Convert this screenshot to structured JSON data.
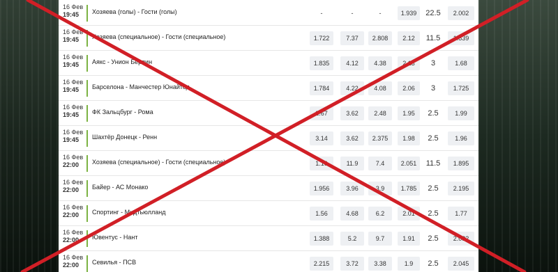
{
  "events": [
    {
      "date": "16 Фев",
      "time": "19:45",
      "teams": "Хозяева (голы) - Гости (голы)",
      "odds": [
        "-",
        "-",
        "-",
        "1.939"
      ],
      "total": "22.5",
      "last": "2.002"
    },
    {
      "date": "16 Фев",
      "time": "19:45",
      "teams": "Хозяева (специальное) - Гости (специальное)",
      "odds": [
        "1.722",
        "7.37",
        "2.808",
        "2.12"
      ],
      "total": "11.5",
      "last": "1.839"
    },
    {
      "date": "16 Фев",
      "time": "19:45",
      "teams": "Аякс - Унион Берлин",
      "odds": [
        "1.835",
        "4.12",
        "4.38",
        "2.13"
      ],
      "total": "3",
      "last": "1.68"
    },
    {
      "date": "16 Фев",
      "time": "19:45",
      "teams": "Барселона - Манчестер Юнайтед",
      "odds": [
        "1.784",
        "4.22",
        "4.08",
        "2.06"
      ],
      "total": "3",
      "last": "1.725"
    },
    {
      "date": "16 Фев",
      "time": "19:45",
      "teams": "ФК Зальцбург - Рома",
      "odds": [
        "2.67",
        "3.62",
        "2.48",
        "1.95"
      ],
      "total": "2.5",
      "last": "1.99"
    },
    {
      "date": "16 Фев",
      "time": "19:45",
      "teams": "Шахтёр Донецк - Ренн",
      "odds": [
        "3.14",
        "3.62",
        "2.375",
        "1.98"
      ],
      "total": "2.5",
      "last": "1.96"
    },
    {
      "date": "16 Фев",
      "time": "22:00",
      "teams": "Хозяева (специальное) - Гости (специальное)",
      "odds": [
        "1.19",
        "11.9",
        "7.4",
        "2.051"
      ],
      "total": "11.5",
      "last": "1.895"
    },
    {
      "date": "16 Фев",
      "time": "22:00",
      "teams": "Байер - АС Монако",
      "odds": [
        "1.956",
        "3.96",
        "3.9",
        "1.785"
      ],
      "total": "2.5",
      "last": "2.195"
    },
    {
      "date": "16 Фев",
      "time": "22:00",
      "teams": "Спортинг - Мидтьюлланд",
      "odds": [
        "1.56",
        "4.68",
        "6.2",
        "2.01"
      ],
      "total": "2.5",
      "last": "1.77"
    },
    {
      "date": "16 Фев",
      "time": "22:00",
      "teams": "Ювентус - Нант",
      "odds": [
        "1.388",
        "5.2",
        "9.7",
        "1.91"
      ],
      "total": "2.5",
      "last": "2.032"
    },
    {
      "date": "16 Фев",
      "time": "22:00",
      "teams": "Севилья - ПСВ",
      "odds": [
        "2.215",
        "3.72",
        "3.38",
        "1.9"
      ],
      "total": "2.5",
      "last": "2.045"
    }
  ],
  "colors": {
    "accent": "#7cb342",
    "cross": "#d11f26",
    "odd_bg": "#eef0f3"
  }
}
